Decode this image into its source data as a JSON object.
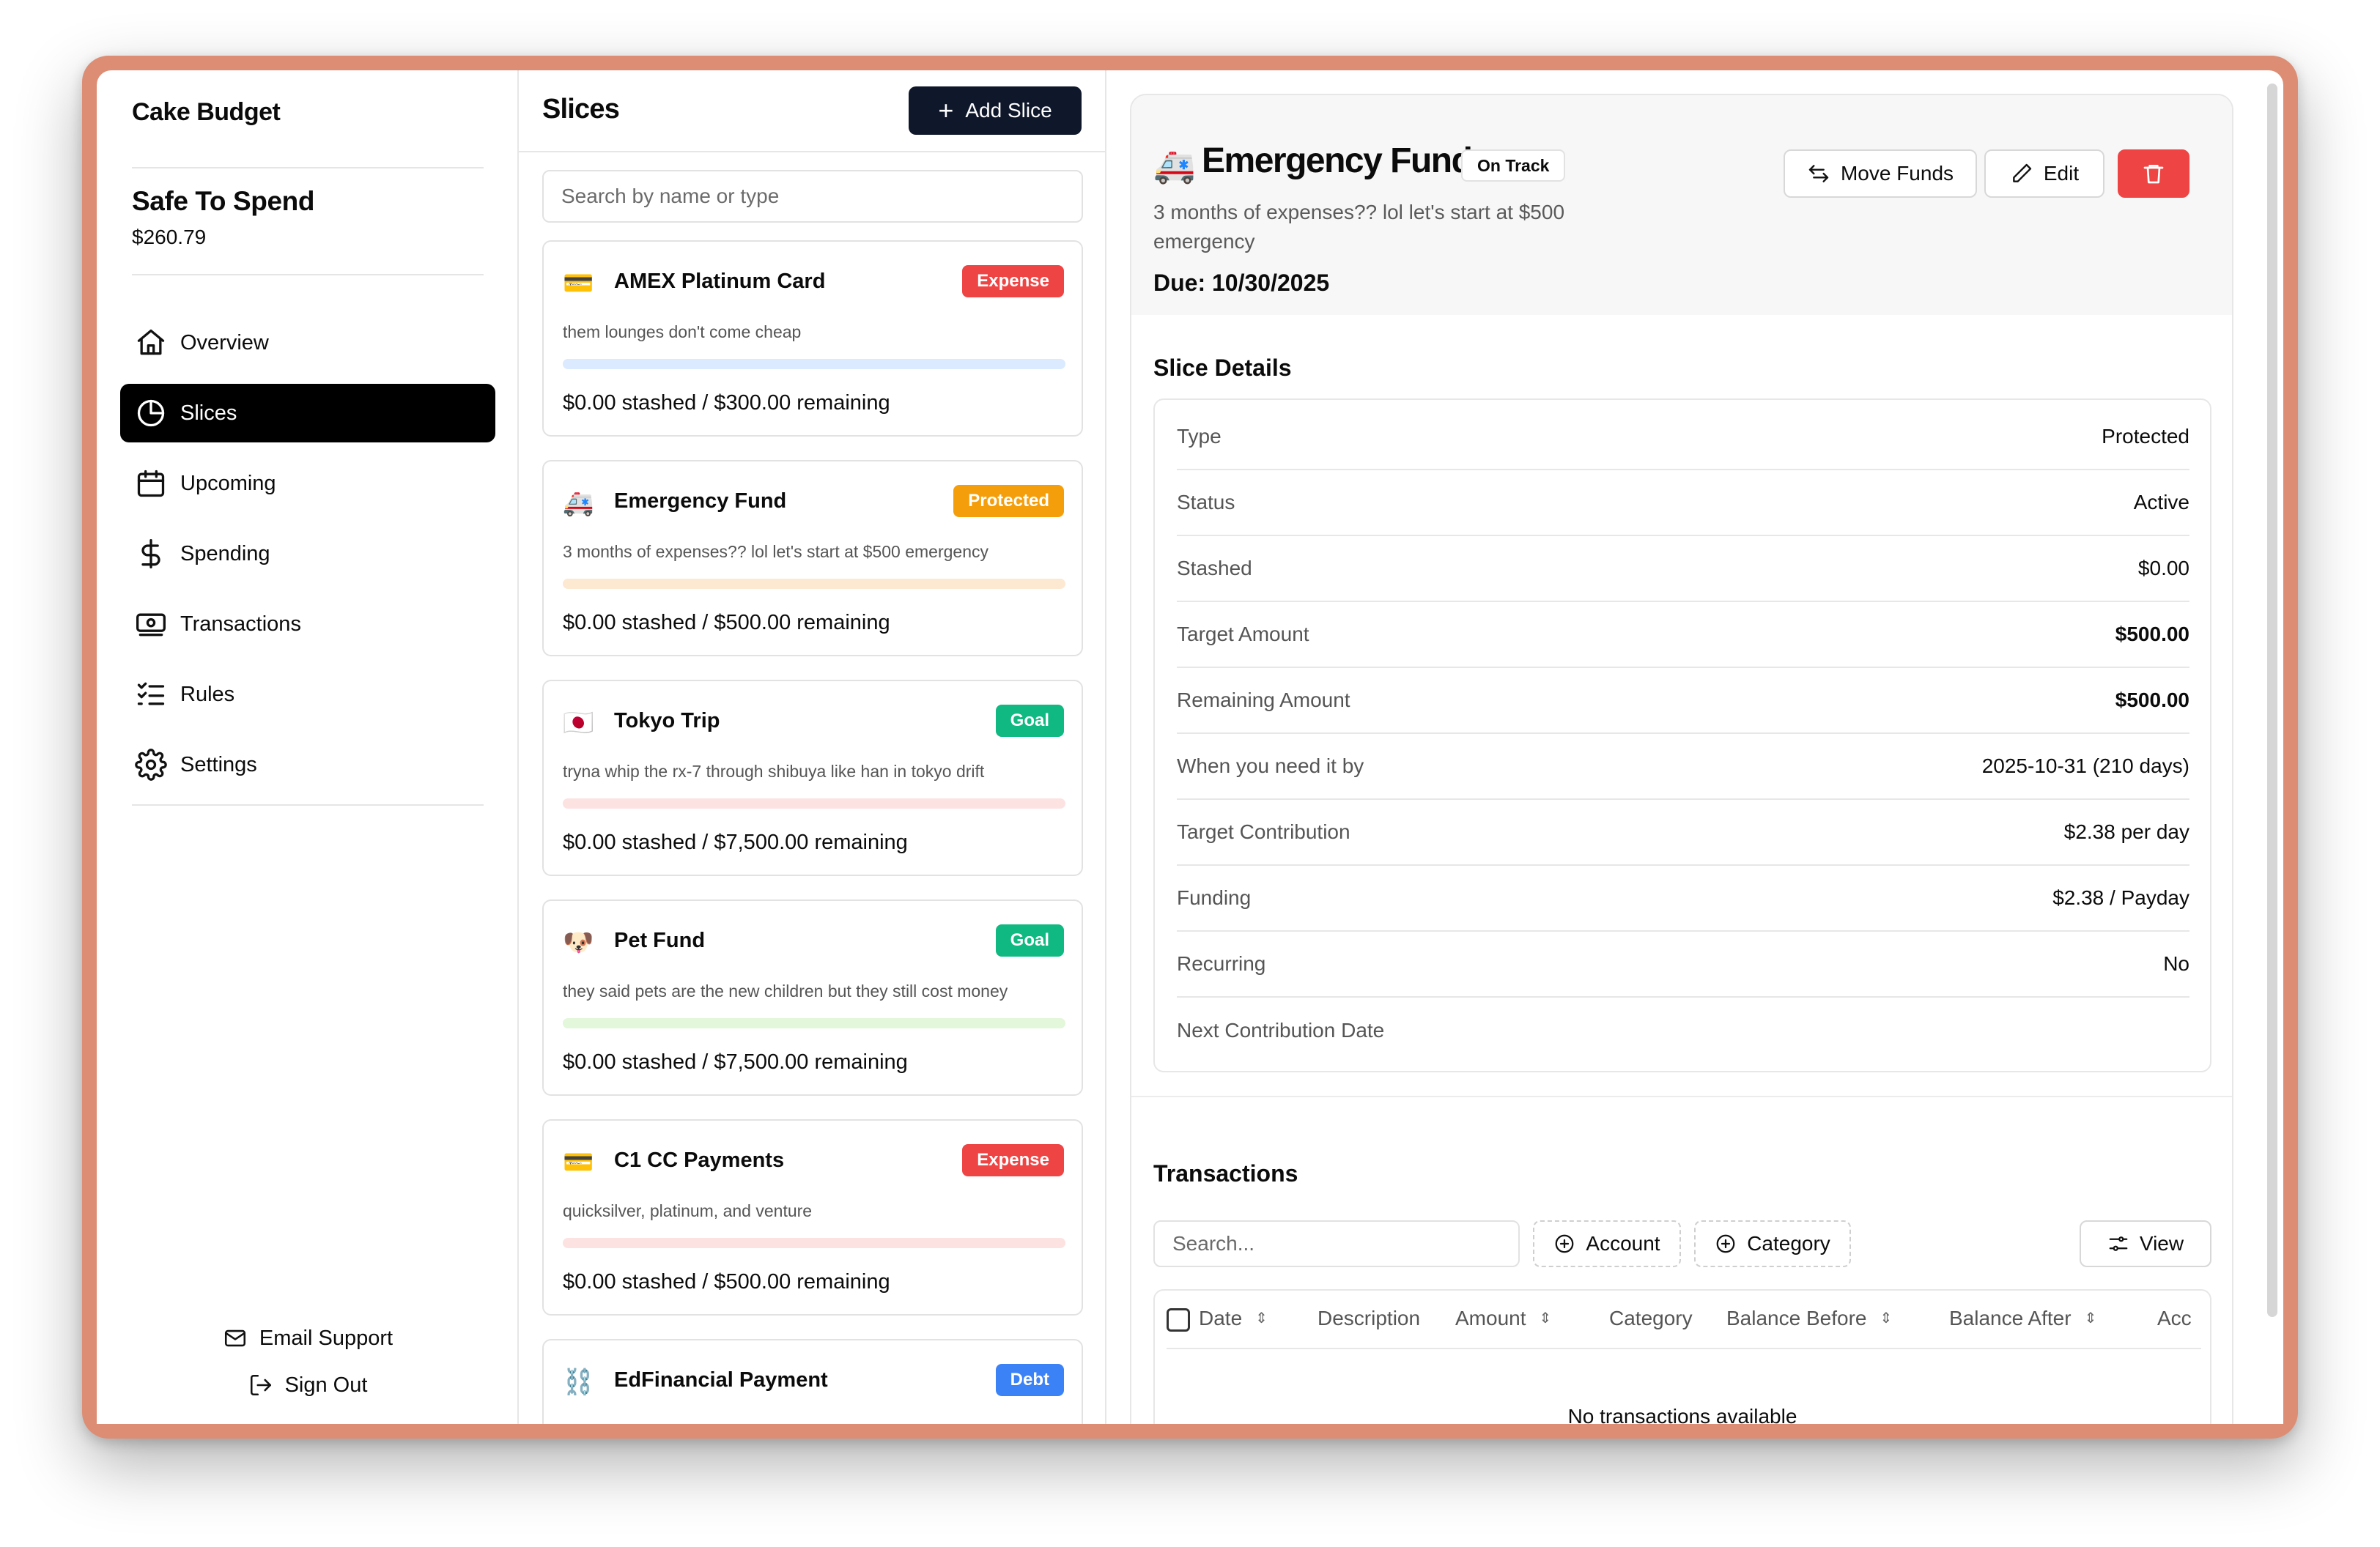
{
  "sidebar": {
    "app_title": "Cake Budget",
    "safe_to_spend_label": "Safe To Spend",
    "safe_to_spend_value": "$260.79",
    "nav": [
      {
        "label": "Overview",
        "icon": "home-icon"
      },
      {
        "label": "Slices",
        "icon": "pie-chart-icon",
        "active": true
      },
      {
        "label": "Upcoming",
        "icon": "calendar-icon"
      },
      {
        "label": "Spending",
        "icon": "dollar-icon"
      },
      {
        "label": "Transactions",
        "icon": "banknote-icon"
      },
      {
        "label": "Rules",
        "icon": "checklist-icon"
      },
      {
        "label": "Settings",
        "icon": "gear-icon"
      }
    ],
    "email_support": "Email Support",
    "sign_out": "Sign Out"
  },
  "slices": {
    "title": "Slices",
    "add_label": "Add Slice",
    "search_placeholder": "Search by name or type",
    "items": [
      {
        "emoji": "💳",
        "name": "AMEX Platinum Card",
        "badge": "Expense",
        "badge_color": "#ef4444",
        "bar_color": "#dbeafe",
        "description": "them lounges don't come cheap",
        "amounts": "$0.00 stashed / $300.00 remaining"
      },
      {
        "emoji": "🚑",
        "name": "Emergency Fund",
        "badge": "Protected",
        "badge_color": "#f59e0b",
        "bar_color": "#fde9d2",
        "description": "3 months of expenses?? lol let's start at $500 emergency",
        "amounts": "$0.00 stashed / $500.00 remaining"
      },
      {
        "emoji": "🇯🇵",
        "name": "Tokyo Trip",
        "badge": "Goal",
        "badge_color": "#10b981",
        "bar_color": "#fde2e2",
        "description": "tryna whip the rx-7 through shibuya like han in tokyo drift",
        "amounts": "$0.00 stashed / $7,500.00 remaining"
      },
      {
        "emoji": "🐶",
        "name": "Pet Fund",
        "badge": "Goal",
        "badge_color": "#10b981",
        "bar_color": "#e3f7da",
        "description": "they said pets are the new children but they still cost money",
        "amounts": "$0.00 stashed / $7,500.00 remaining"
      },
      {
        "emoji": "💳",
        "name": "C1 CC Payments",
        "badge": "Expense",
        "badge_color": "#ef4444",
        "bar_color": "#fde2e2",
        "description": "quicksilver, platinum, and venture",
        "amounts": "$0.00 stashed / $500.00 remaining"
      },
      {
        "emoji": "⛓️",
        "name": "EdFinancial Payment",
        "badge": "Debt",
        "badge_color": "#3b82f6",
        "bar_color": "#e5e7eb",
        "description": "",
        "amounts": ""
      }
    ]
  },
  "detail": {
    "emoji": "🚑",
    "title": "Emergency Fund",
    "status": "On Track",
    "description": "3 months of expenses?? lol let's start at $500 emergency",
    "due": "Due: 10/30/2025",
    "move_funds_label": "Move Funds",
    "edit_label": "Edit",
    "slice_details_title": "Slice Details",
    "rows": [
      {
        "label": "Type",
        "value": "Protected",
        "bold": false
      },
      {
        "label": "Status",
        "value": "Active",
        "bold": false
      },
      {
        "label": "Stashed",
        "value": "$0.00",
        "bold": false
      },
      {
        "label": "Target Amount",
        "value": "$500.00",
        "bold": true
      },
      {
        "label": "Remaining Amount",
        "value": "$500.00",
        "bold": true
      },
      {
        "label": "When you need it by",
        "value": "2025-10-31 (210 days)",
        "bold": false
      },
      {
        "label": "Target Contribution",
        "value": "$2.38 per day",
        "bold": false
      },
      {
        "label": "Funding",
        "value": "$2.38 / Payday",
        "bold": false
      },
      {
        "label": "Recurring",
        "value": "No",
        "bold": false
      },
      {
        "label": "Next Contribution Date",
        "value": "",
        "bold": false
      }
    ],
    "transactions": {
      "title": "Transactions",
      "search_placeholder": "Search...",
      "account_label": "Account",
      "category_label": "Category",
      "view_label": "View",
      "columns": [
        "Date",
        "Description",
        "Amount",
        "Category",
        "Balance Before",
        "Balance After",
        "Acc"
      ],
      "empty_text": "No transactions available"
    }
  },
  "colors": {
    "accent_dark": "#0f172a",
    "delete_red": "#ef4444",
    "window_frame": "#dd8d74"
  }
}
